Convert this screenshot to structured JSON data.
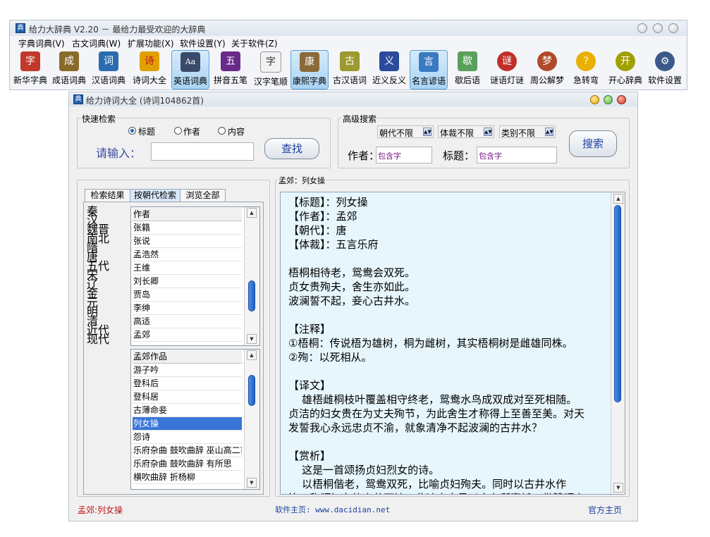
{
  "main_window": {
    "title": "给力大辞典 V2.20 － 最给力最受欢迎的大辞典",
    "menu": [
      "字典词典(V)",
      "古文词典(W)",
      "扩展功能(X)",
      "软件设置(Y)",
      "关于软件(Z)"
    ],
    "toolbar": [
      {
        "label": "新华字典",
        "icon": "字",
        "color": "#c0392b"
      },
      {
        "label": "成语词典",
        "icon": "成",
        "color": "#8a6a2a"
      },
      {
        "label": "汉语词典",
        "icon": "词",
        "color": "#2b6cb0"
      },
      {
        "label": "诗词大全",
        "icon": "诗",
        "color": "#e0a000"
      },
      {
        "label": "英语词典",
        "icon": "Aa",
        "color": "#3b4a6b"
      },
      {
        "label": "拼音五笔",
        "icon": "五",
        "color": "#6a2a8a"
      },
      {
        "label": "汉字笔顺",
        "icon": "字",
        "color": "#777777"
      },
      {
        "label": "康熙字典",
        "icon": "康",
        "color": "#8a6a3a"
      },
      {
        "label": "古汉语词",
        "icon": "古",
        "color": "#9a9a30"
      },
      {
        "label": "近义反义",
        "icon": "义",
        "color": "#2a4a9a"
      },
      {
        "label": "名言谚语",
        "icon": "言",
        "color": "#3a7ac0"
      },
      {
        "label": "歇后语",
        "icon": "歇",
        "color": "#5aa05a"
      },
      {
        "label": "谜语灯谜",
        "icon": "谜",
        "color": "#c0302a"
      },
      {
        "label": "周公解梦",
        "icon": "梦",
        "color": "#b04a2a"
      },
      {
        "label": "急转弯",
        "icon": "?",
        "color": "#e8b000"
      },
      {
        "label": "开心辞典",
        "icon": "开",
        "color": "#a0a000"
      },
      {
        "label": "软件设置",
        "icon": "⚙",
        "color": "#3a5a8a"
      }
    ]
  },
  "child_window": {
    "title": "给力诗词大全  (诗词104862首)",
    "quick_search": {
      "label": "快速检索",
      "radio_options": [
        "标题",
        "作者",
        "内容"
      ],
      "selected_option": "标题",
      "input_label": "请输入：",
      "input_value": "",
      "button": "查找"
    },
    "advanced_search": {
      "label": "高级搜索",
      "dynasty": "朝代不限",
      "genre": "体裁不限",
      "category": "类别不限",
      "author_label": "作者：",
      "author_placeholder": "包含字",
      "title_label": "标题：",
      "title_placeholder": "包含字",
      "button": "搜索"
    },
    "tabs": [
      "检索结果",
      "按朝代检索",
      "浏览全部"
    ],
    "active_tab": "按朝代检索",
    "dynasties": [
      "秦",
      "汉",
      "魏晋",
      "南北",
      "隋",
      "唐",
      "五代",
      "宋",
      "辽",
      "金",
      "元",
      "明",
      "清",
      "近代",
      "现代"
    ],
    "authors": {
      "header": "作者",
      "items": [
        "张籍",
        "张说",
        "孟浩然",
        "王维",
        "刘长卿",
        "贾岛",
        "李绅",
        "高适",
        "孟郊"
      ]
    },
    "works": {
      "header": "孟郊作品",
      "items": [
        "游子吟",
        "登科后",
        "登科居",
        "古薄命妾",
        "列女操",
        "怨诗",
        "乐府杂曲 鼓吹曲辞 巫山高二首",
        "乐府杂曲 鼓吹曲辞 有所思",
        "横吹曲辞 折杨柳"
      ],
      "selected": "列女操"
    },
    "poem_panel_label": "孟郊：列女操",
    "poem_text": "【标题】：列女操\n【作者】：孟郊\n【朝代】：唐\n【体裁】：五言乐府\n\n梧桐相待老，鸳鸯会双死。\n贞女贵殉夫，舍生亦如此。\n波澜誓不起，妾心古井水。\n\n【注释】\n①梧桐：传说梧为雄树，桐为雌树，其实梧桐树是雌雄同株。\n②殉：以死相从。\n\n【译文】\n    雄梧雌桐枝叶覆盖相守终老，鸳鸯水鸟成双成对至死相随。\n贞洁的妇女贵在为丈夫殉节，为此舍生才称得上至善至美。对天\n发誓我心永远忠贞不渝，就象清净不起波澜的古井水？\n\n【赏析】\n    这是一首颂扬贞妇烈女的诗。\n    以梧桐偕老，鸳鸯双死，比喻贞妇殉夫。同时以古井水作\n比，称颂妇女的守节不嫁，此诗内容虽以古有所寄托，借赞颂贞",
    "status": {
      "left": "孟郊:列女操",
      "center": "软件主页: www.dacidian.net",
      "right": "官方主页"
    }
  }
}
